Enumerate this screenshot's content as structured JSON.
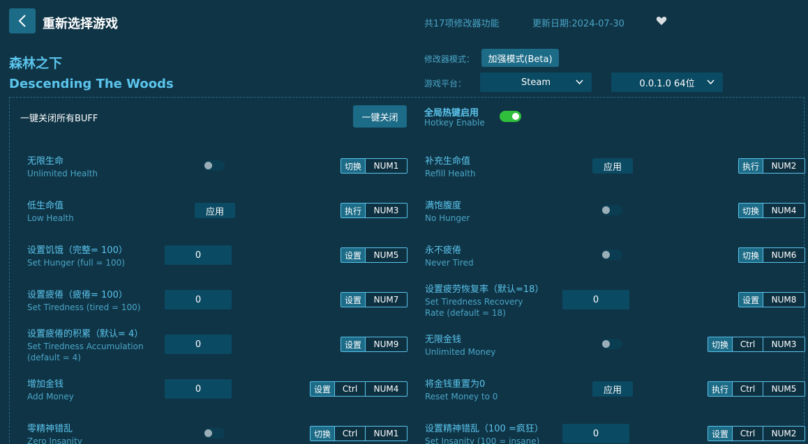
{
  "header": {
    "title": "重新选择游戏",
    "features": "共17项修改器功能",
    "updated": "更新日期:2024-07-30"
  },
  "game": {
    "title_cn": "森林之下",
    "title_en": "Descending The Woods"
  },
  "settings": {
    "mode_label": "修改器模式：",
    "mode_value": "加强模式(Beta)",
    "platform_label": "游戏平台：",
    "platform_value": "Steam",
    "version_value": "0.0.1.0 64位"
  },
  "panel": {
    "buff_label": "一键关闭所有BUFF",
    "close_all": "一键关闭",
    "hotkey_cn": "全局热键启用",
    "hotkey_en": "Hotkey Enable",
    "hotkey_enabled": true
  },
  "options": [
    {
      "cn": "无限生命",
      "en": "Unlimited Health",
      "control": "toggle",
      "action": "切换",
      "keys": [
        "NUM1"
      ]
    },
    {
      "cn": "补充生命值",
      "en": "Refill Health",
      "control": "apply",
      "button": "应用",
      "action": "执行",
      "keys": [
        "NUM2"
      ]
    },
    {
      "cn": "低生命值",
      "en": "Low Health",
      "control": "apply",
      "button": "应用",
      "action": "执行",
      "keys": [
        "NUM3"
      ]
    },
    {
      "cn": "满饱腹度",
      "en": "No Hunger",
      "control": "toggle",
      "action": "切换",
      "keys": [
        "NUM4"
      ]
    },
    {
      "cn": "设置饥饿（完整= 100）",
      "en": "Set Hunger (full = 100)",
      "control": "input",
      "value": "0",
      "action": "设置",
      "keys": [
        "NUM5"
      ]
    },
    {
      "cn": "永不疲倦",
      "en": "Never Tired",
      "control": "toggle",
      "action": "切换",
      "keys": [
        "NUM6"
      ]
    },
    {
      "cn": "设置疲倦（疲倦= 100）",
      "en": "Set Tiredness (tired = 100)",
      "control": "input",
      "value": "0",
      "action": "设置",
      "keys": [
        "NUM7"
      ]
    },
    {
      "cn": "设置疲劳恢复率（默认=18）",
      "en": "Set Tiredness Recovery Rate (default = 18)",
      "control": "input",
      "value": "0",
      "action": "设置",
      "keys": [
        "NUM8"
      ]
    },
    {
      "cn": "设置疲倦的积累（默认= 4）",
      "en": "Set Tiredness Accumulation (default = 4)",
      "control": "input",
      "value": "0",
      "action": "设置",
      "keys": [
        "NUM9"
      ]
    },
    {
      "cn": "无限金钱",
      "en": "Unlimited Money",
      "control": "toggle",
      "action": "切换",
      "keys": [
        "Ctrl",
        "NUM3"
      ]
    },
    {
      "cn": "增加金钱",
      "en": "Add Money",
      "control": "input",
      "value": "0",
      "action": "设置",
      "keys": [
        "Ctrl",
        "NUM4"
      ]
    },
    {
      "cn": "将金钱重置为0",
      "en": "Reset Money to 0",
      "control": "apply",
      "button": "应用",
      "action": "执行",
      "keys": [
        "Ctrl",
        "NUM5"
      ]
    },
    {
      "cn": "零精神错乱",
      "en": "Zero Insanity",
      "control": "toggle",
      "action": "切换",
      "keys": [
        "Ctrl",
        "NUM1"
      ]
    },
    {
      "cn": "设置精神错乱（100 =疯狂）",
      "en": "Set Insanity (100 = insane)",
      "control": "input",
      "value": "0",
      "action": "设置",
      "keys": [
        "Ctrl",
        "NUM2"
      ]
    }
  ]
}
